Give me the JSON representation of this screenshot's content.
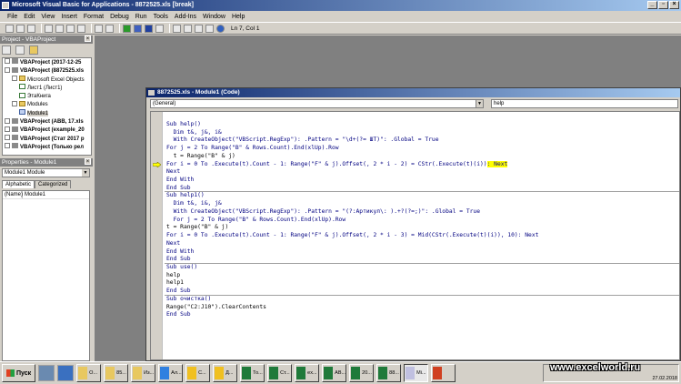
{
  "window": {
    "title": "Microsoft Visual Basic for Applications - 8872525.xls [break]"
  },
  "menu": [
    "File",
    "Edit",
    "View",
    "Insert",
    "Format",
    "Debug",
    "Run",
    "Tools",
    "Add-Ins",
    "Window",
    "Help"
  ],
  "toolbar": {
    "cursor_position": "Ln 7, Col 1"
  },
  "project": {
    "title": "Project - VBAProject",
    "tree": [
      {
        "label": "VBAProject (2017-12-25",
        "level": 0,
        "kind": "proj",
        "bold": true
      },
      {
        "label": "VBAProject (8872525.xls",
        "level": 0,
        "kind": "proj",
        "bold": true
      },
      {
        "label": "Microsoft Excel Objects",
        "level": 1,
        "kind": "folder"
      },
      {
        "label": "Лист1 (Лист1)",
        "level": 2,
        "kind": "sheet"
      },
      {
        "label": "ЭтаКнига",
        "level": 2,
        "kind": "sheet"
      },
      {
        "label": "Modules",
        "level": 1,
        "kind": "folder"
      },
      {
        "label": "Module1",
        "level": 2,
        "kind": "mod",
        "selected": true
      },
      {
        "label": "VBAProject (ABB, 17.xls",
        "level": 0,
        "kind": "proj",
        "bold": true
      },
      {
        "label": "VBAProject (example_20",
        "level": 0,
        "kind": "proj",
        "bold": true
      },
      {
        "label": "VBAProject (Стат 2017 р",
        "level": 0,
        "kind": "proj",
        "bold": true
      },
      {
        "label": "VBAProject (Только рел",
        "level": 0,
        "kind": "proj",
        "bold": true
      }
    ]
  },
  "properties": {
    "title": "Properties - Module1",
    "selected_object": "Module1 Module",
    "tabs": [
      "Alphabetic",
      "Categorized"
    ],
    "rows": [
      {
        "key": "(Name)",
        "value": "Module1"
      }
    ]
  },
  "code_window": {
    "title": "8872525.xls - Module1 (Code)",
    "object_combo": "(General)",
    "proc_combo": "help",
    "current_line_index": 6,
    "lines": [
      {
        "text": "Sub help()"
      },
      {
        "text": "  Dim t&, j&, i&"
      },
      {
        "text": "  With CreateObject(\"VBScript.RegExp\"): .Pattern = \"\\d+(?= ШТ)\": .Global = True"
      },
      {
        "text": "For j = 2 To Range(\"B\" & Rows.Count).End(xlUp).Row"
      },
      {
        "text": "  t = Range(\"B\" & j)"
      },
      {
        "text": "For i = 0 To .Execute(t).Count - 1: Range(\"F\" & j).Offset(, 2 * i - 2) = CStr(.Execute(t)(i))",
        "hl": ": Next"
      },
      {
        "text": "Next"
      },
      {
        "text": "End With"
      },
      {
        "text": "End Sub",
        "sep": true
      },
      {
        "text": "Sub help1()"
      },
      {
        "text": "  Dim t&, i&, j&"
      },
      {
        "text": "  With CreateObject(\"VBScript.RegExp\"): .Pattern = \"(?:Артикул\\: ).+?(?=;)\": .Global = True"
      },
      {
        "text": "  For j = 2 To Range(\"B\" & Rows.Count).End(xlUp).Row"
      },
      {
        "text": "t = Range(\"B\" & j)"
      },
      {
        "text": "For i = 0 To .Execute(t).Count - 1: Range(\"F\" & j).Offset(, 2 * i - 3) = Mid(CStr(.Execute(t)(i)), 10): Next"
      },
      {
        "text": "Next"
      },
      {
        "text": "End With"
      },
      {
        "text": "End Sub",
        "sep": true
      },
      {
        "text": "Sub use()"
      },
      {
        "text": "help"
      },
      {
        "text": "help1"
      },
      {
        "text": "End Sub",
        "sep": true
      },
      {
        "text": "Sub очистка()"
      },
      {
        "text": "Range(\"C2:J10\").ClearContents"
      },
      {
        "text": "End Sub"
      }
    ]
  },
  "taskbar": {
    "start_label": "Пуск",
    "tasks": [
      {
        "label": "О...",
        "icon": "folder-icon",
        "color": "#e8c860"
      },
      {
        "label": "85...",
        "icon": "folder-icon",
        "color": "#e8c860"
      },
      {
        "label": "Из...",
        "icon": "folder-icon",
        "color": "#e8c860"
      },
      {
        "label": "Ал...",
        "icon": "app-icon",
        "color": "#3080e0"
      },
      {
        "label": "С...",
        "icon": "1c-icon",
        "color": "#f0c020"
      },
      {
        "label": "Д...",
        "icon": "1c-icon",
        "color": "#f0c020"
      },
      {
        "label": "То...",
        "icon": "excel-icon",
        "color": "#1f7a3a"
      },
      {
        "label": "Ст...",
        "icon": "excel-icon",
        "color": "#1f7a3a"
      },
      {
        "label": "ex...",
        "icon": "excel-icon",
        "color": "#1f7a3a"
      },
      {
        "label": "AB...",
        "icon": "excel-icon",
        "color": "#1f7a3a"
      },
      {
        "label": "20...",
        "icon": "excel-icon",
        "color": "#1f7a3a"
      },
      {
        "label": "88...",
        "icon": "excel-icon",
        "color": "#1f7a3a"
      },
      {
        "label": "Mi...",
        "icon": "vba-icon",
        "color": "#c0c0e0",
        "active": true
      },
      {
        "label": "",
        "icon": "powerpoint-icon",
        "color": "#d04020"
      }
    ],
    "watermark": "www.excelworld.ru",
    "clock_date": "27.02.2018"
  }
}
